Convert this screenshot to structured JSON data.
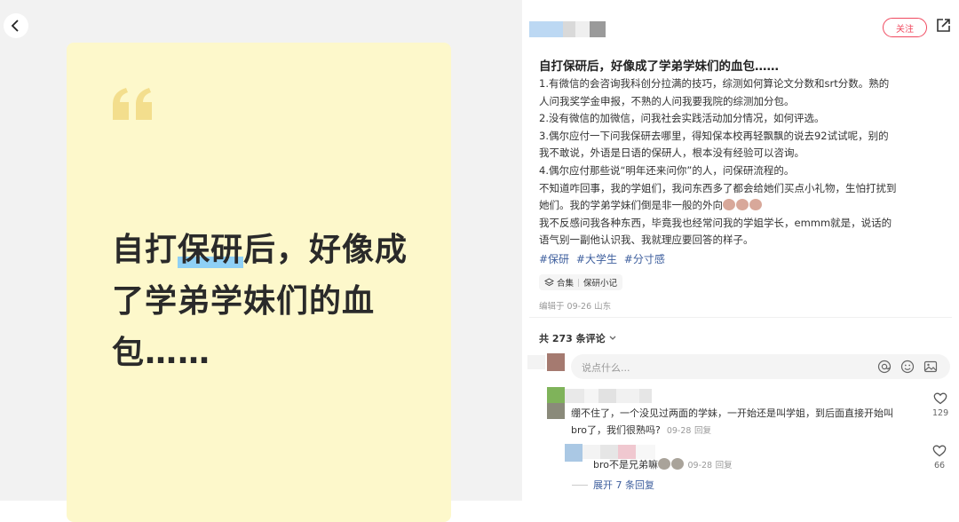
{
  "cover": {
    "title_before": "自打",
    "title_highlight": "保研",
    "title_after": "后，好像成了学弟学妹们的血包……"
  },
  "post": {
    "follow_label": "关注",
    "title": "自打保研后，好像成了学弟学妹们的血包……",
    "body": [
      "1.有微信的会咨询我科创分拉满的技巧，综测如何算论文分数和srt分数。熟的",
      "人问我奖学金申报，不熟的人问我要我院的综测加分包。",
      "2.没有微信的加微信，问我社会实践活动加分情况，如何评选。",
      "3.偶尔应付一下问我保研去哪里，得知保本校再轻飘飘的说去92试试呢，别的",
      "我不敢说，外语是日语的保研人，根本没有经验可以咨询。",
      "4.偶尔应付那些说“明年还来问你”的人，问保研流程的。",
      "不知道咋回事，我的学姐们，我问东西多了都会给她们买点小礼物，生怕打扰到",
      "她们。我的学弟学妹们倒是非一般的外向",
      "我不反感问我各种东西，毕竟我也经常问我的学姐学长，emmm就是，说话的",
      "语气别一副他认识我、我就理应要回答的样子。"
    ],
    "tags": [
      "#保研",
      "#大学生",
      "#分寸感"
    ],
    "collection_label": "合集",
    "collection_name": "保研小记",
    "edit_info": "编辑于 09-26 山东",
    "comment_count": "共 273 条评论"
  },
  "comment_box": {
    "placeholder": "说点什么..."
  },
  "comments": [
    {
      "text_line1": "绷不住了，一个没见过两面的学妹，一开始还是叫学姐，到后面直接开始叫",
      "text_line2": "bro了，我们很熟吗?",
      "date": "09-28",
      "reply_label": "回复",
      "likes": "129"
    },
    {
      "text": "bro不是兄弟嘛",
      "date": "09-28",
      "reply_label": "回复",
      "likes": "66"
    }
  ],
  "expand_label": "展开 7 条回复",
  "colors": {
    "accent": "#f0495f",
    "link": "#3d5e9d",
    "cover_bg": "#fdf8cb",
    "highlight": "#8ed0f5",
    "quote": "#f3de8d"
  },
  "icons": [
    "back-arrow-icon",
    "quote-mark-icon",
    "share-icon",
    "layers-icon",
    "chevron-down-icon",
    "at-icon",
    "emoji-icon",
    "image-icon",
    "heart-icon"
  ]
}
